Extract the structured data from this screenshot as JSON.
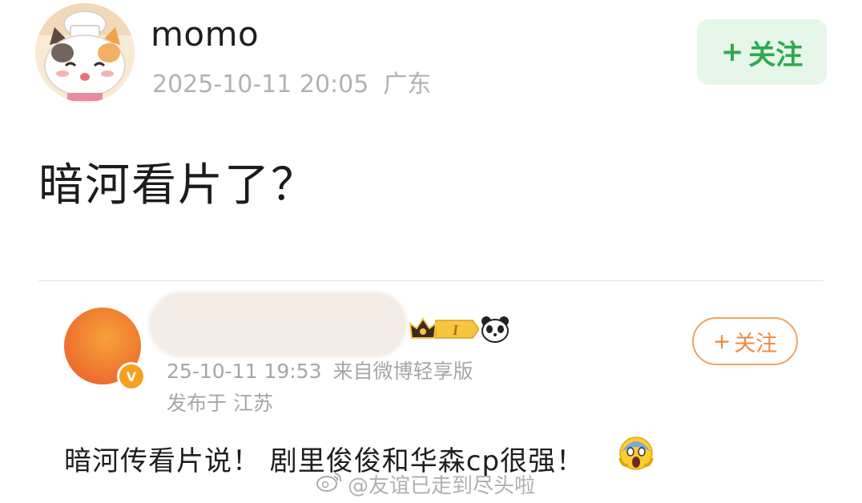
{
  "post": {
    "username": "momo",
    "date": "2025-10-11 20:05",
    "location": "广东",
    "follow_plus": "+",
    "follow_label": "关注",
    "text": "暗河看片了？"
  },
  "comment": {
    "date": "25-10-11 19:53",
    "source": "来自微博轻享版",
    "published_at": "发布于 江苏",
    "follow_plus": "+",
    "follow_label": "关注",
    "text": "暗河传看片说！ 剧里俊俊和华森cp很强！",
    "badge_level": "I"
  },
  "watermark": {
    "text": "@友谊已走到尽头啦"
  },
  "colors": {
    "follow_green_bg": "#e6f6e8",
    "follow_green_text": "#2fa84f",
    "follow_orange": "#ef8a3f",
    "meta_gray": "#b2b2b2"
  },
  "icons": [
    "cat-chef-avatar-icon",
    "verified-v-icon",
    "crown-badge-icon",
    "panda-icon",
    "screaming-face-emoji-icon",
    "weibo-logo-icon"
  ]
}
